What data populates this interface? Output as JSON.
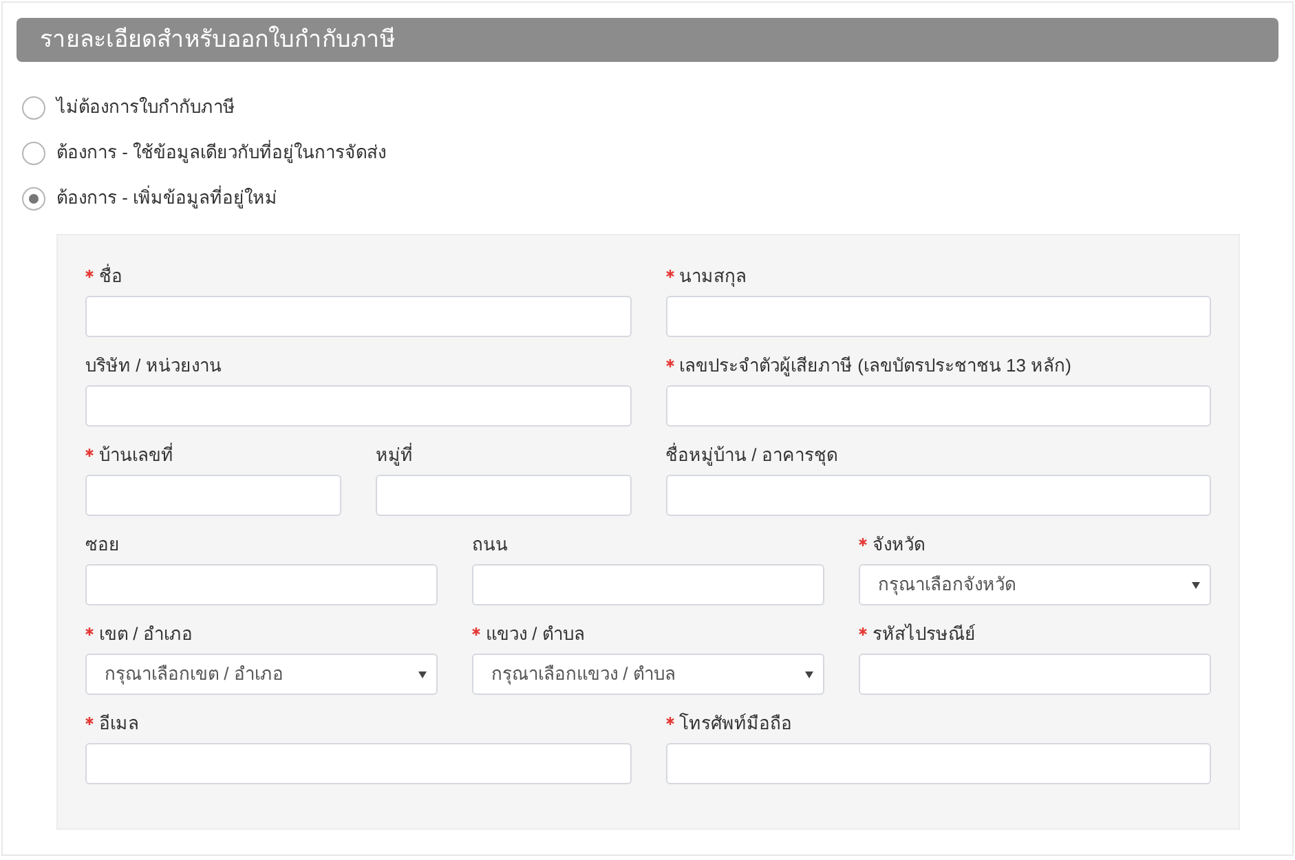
{
  "section": {
    "title": "รายละเอียดสำหรับออกใบกำกับภาษี"
  },
  "options": [
    {
      "label": "ไม่ต้องการใบกำกับภาษี",
      "selected": false
    },
    {
      "label": "ต้องการ - ใช้ข้อมูลเดียวกับที่อยู่ในการจัดส่ง",
      "selected": false
    },
    {
      "label": "ต้องการ - เพิ่มข้อมูลที่อยู่ใหม่",
      "selected": true
    }
  ],
  "form": {
    "rows": [
      {
        "columns": [
          [
            {
              "label": "ชื่อ",
              "required": true,
              "kind": "text"
            }
          ],
          [
            {
              "label": "นามสกุล",
              "required": true,
              "kind": "text"
            }
          ]
        ]
      },
      {
        "columns": [
          [
            {
              "label": "บริษัท / หน่วยงาน",
              "required": false,
              "kind": "text"
            }
          ],
          [
            {
              "label": "เลขประจำตัวผู้เสียภาษี (เลขบัตรประชาชน 13 หลัก)",
              "required": true,
              "kind": "text"
            }
          ]
        ]
      },
      {
        "columns": [
          [
            {
              "label": "บ้านเลขที่",
              "required": true,
              "kind": "text"
            },
            {
              "label": "หมู่ที่",
              "required": false,
              "kind": "text"
            }
          ],
          [
            {
              "label": "ชื่อหมู่บ้าน / อาคารชุด",
              "required": false,
              "kind": "text"
            }
          ]
        ]
      },
      {
        "columns": [
          [
            {
              "label": "ซอย",
              "required": false,
              "kind": "text"
            }
          ],
          [
            {
              "label": "ถนน",
              "required": false,
              "kind": "text"
            }
          ],
          [
            {
              "label": "จังหวัด",
              "required": true,
              "kind": "select",
              "placeholder": "กรุณาเลือกจังหวัด"
            }
          ]
        ]
      },
      {
        "columns": [
          [
            {
              "label": "เขต / อำเภอ",
              "required": true,
              "kind": "select",
              "placeholder": "กรุณาเลือกเขต / อำเภอ"
            }
          ],
          [
            {
              "label": "แขวง / ตำบล",
              "required": true,
              "kind": "select",
              "placeholder": "กรุณาเลือกแขวง / ตำบล"
            }
          ],
          [
            {
              "label": "รหัสไปรษณีย์",
              "required": true,
              "kind": "text"
            }
          ]
        ]
      },
      {
        "columns": [
          [
            {
              "label": "อีเมล",
              "required": true,
              "kind": "text"
            }
          ],
          [
            {
              "label": "โทรศัพท์มือถือ",
              "required": true,
              "kind": "text"
            }
          ]
        ]
      }
    ]
  }
}
